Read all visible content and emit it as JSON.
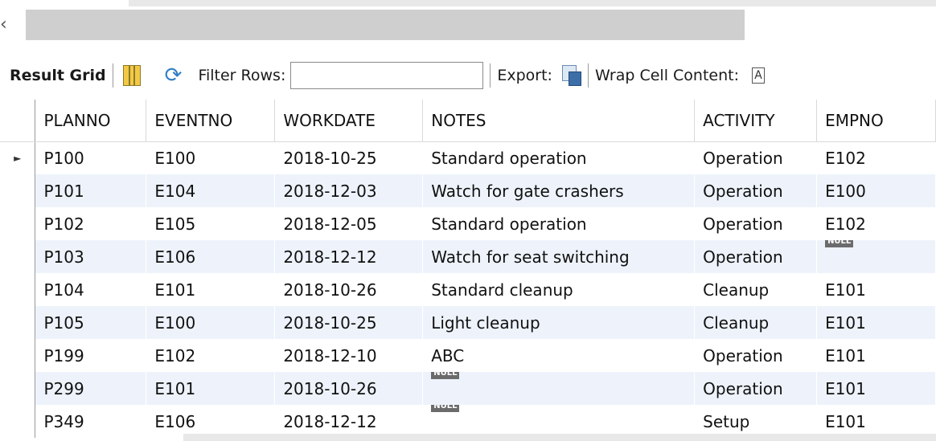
{
  "toolbar": {
    "result_grid_label": "Result Grid",
    "filter_label": "Filter Rows:",
    "filter_value": "",
    "export_label": "Export:",
    "wrap_label": "Wrap Cell Content:",
    "wrap_icon_glyph": "A"
  },
  "columns": [
    "PLANNO",
    "EVENTNO",
    "WORKDATE",
    "NOTES",
    "ACTIVITY",
    "EMPNO"
  ],
  "rows": [
    [
      "P100",
      "E100",
      "2018-10-25",
      "Standard operation",
      "Operation",
      "E102"
    ],
    [
      "P101",
      "E104",
      "2018-12-03",
      "Watch for gate crashers",
      "Operation",
      "E100"
    ],
    [
      "P102",
      "E105",
      "2018-12-05",
      "Standard operation",
      "Operation",
      "E102"
    ],
    [
      "P103",
      "E106",
      "2018-12-12",
      "Watch for seat switching",
      "Operation",
      null
    ],
    [
      "P104",
      "E101",
      "2018-10-26",
      "Standard cleanup",
      "Cleanup",
      "E101"
    ],
    [
      "P105",
      "E100",
      "2018-10-25",
      "Light cleanup",
      "Cleanup",
      "E101"
    ],
    [
      "P199",
      "E102",
      "2018-12-10",
      "ABC",
      "Operation",
      "E101"
    ],
    [
      "P299",
      "E101",
      "2018-10-26",
      null,
      "Operation",
      "E101"
    ],
    [
      "P349",
      "E106",
      "2018-12-12",
      null,
      "Setup",
      "E101"
    ]
  ],
  "null_label": "NULL",
  "selected_row_marker": "►",
  "icons": {
    "result-grid-icon": "grid-icon",
    "refresh-icon": "refresh-icon",
    "export-icon": "export-icon",
    "wrap-icon": "wrap-icon"
  }
}
